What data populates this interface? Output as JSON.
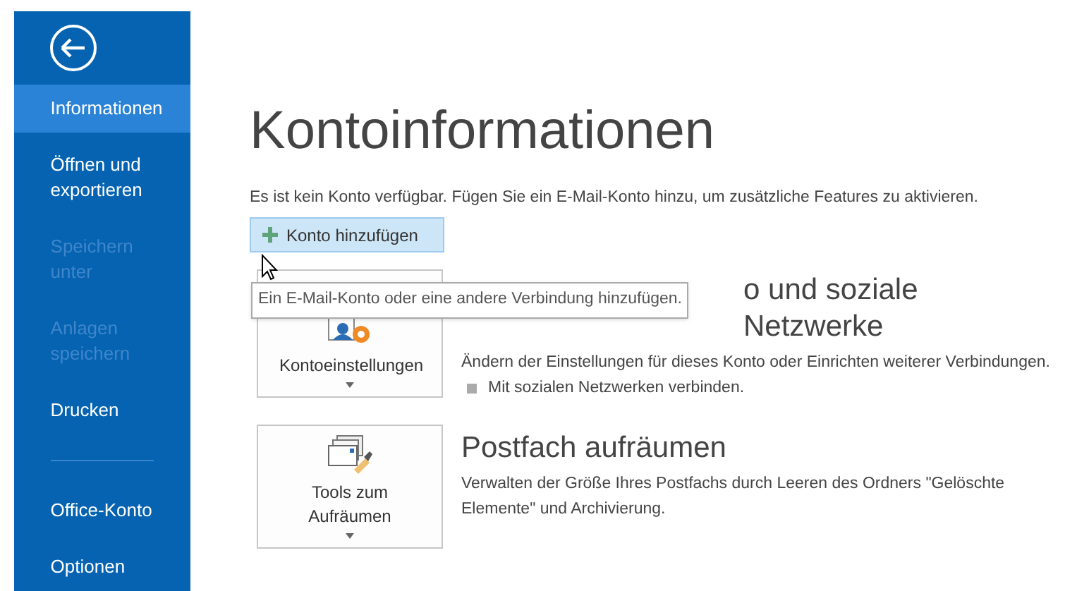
{
  "sidebar": {
    "items": [
      {
        "label": "Informationen",
        "selected": true,
        "disabled": false
      },
      {
        "label": "Öffnen und exportieren",
        "selected": false,
        "disabled": false
      },
      {
        "label": "Speichern unter",
        "selected": false,
        "disabled": true
      },
      {
        "label": "Anlagen speichern",
        "selected": false,
        "disabled": true
      },
      {
        "label": "Drucken",
        "selected": false,
        "disabled": false
      }
    ],
    "bottom_items": [
      {
        "label": "Office-Konto",
        "selected": false,
        "disabled": false
      },
      {
        "label": "Optionen",
        "selected": false,
        "disabled": false
      }
    ]
  },
  "title": "Kontoinformationen",
  "message": "Es ist kein Konto verfügbar. Fügen Sie ein E-Mail-Konto hinzu, um zusätzliche Features zu aktivieren.",
  "add_button": {
    "label": "Konto hinzufügen"
  },
  "tooltip": "Ein E-Mail-Konto oder eine andere Verbindung hinzufügen.",
  "sections": [
    {
      "kind": "settings",
      "button": "Kontoeinstellungen",
      "heading": "o und soziale Netzwerke",
      "text": "Ändern der Einstellungen für dieses Konto oder Einrichten weiterer Verbindungen.",
      "bullets": [
        "Mit sozialen Netzwerken verbinden."
      ]
    },
    {
      "kind": "cleanup",
      "button": "Tools zum Aufräumen",
      "heading": "Postfach aufräumen",
      "text": "Verwalten der Größe Ihres Postfachs durch Leeren des Ordners \"Gelöschte Elemente\" und Archivierung."
    }
  ]
}
